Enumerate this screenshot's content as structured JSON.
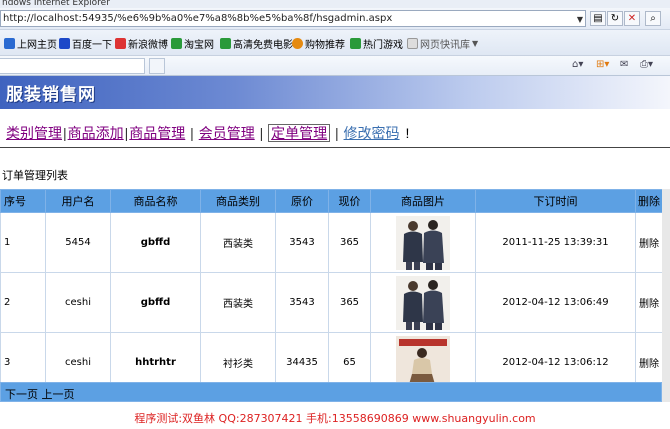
{
  "window": {
    "title": "ndows Internet Explorer"
  },
  "address": {
    "url": "http://localhost:54935/%e6%9b%a0%e7%a8%8b%e5%ba%8f/hsgadmin.aspx"
  },
  "favorites": [
    {
      "label": "上网主页",
      "color": "#2a6ad1"
    },
    {
      "label": "百度一下",
      "color": "#1d48c8"
    },
    {
      "label": "新浪微博",
      "color": "#d33"
    },
    {
      "label": "淘宝网",
      "color": "#2a9a3a"
    },
    {
      "label": "高清免费电影",
      "color": "#2a9a3a"
    },
    {
      "label": "购物推荐",
      "color": "#e58a10"
    },
    {
      "label": "热门游戏",
      "color": "#2a9a3a"
    },
    {
      "label": "网页快讯库",
      "color": "#888"
    }
  ],
  "banner": {
    "title": "服装销售网"
  },
  "nav": {
    "items": [
      "类别管理",
      "商品添加",
      "商品管理",
      "会员管理",
      "定单管理",
      "修改密码"
    ],
    "trailing": "!"
  },
  "list": {
    "title": "订单管理列表",
    "headers": [
      "序号",
      "用户名",
      "商品名称",
      "商品类别",
      "原价",
      "现价",
      "商品图片",
      "下订时间",
      "删除"
    ],
    "rows": [
      {
        "id": "1",
        "user": "5454",
        "name": "gbffd",
        "category": "西装类",
        "orig": "3543",
        "price": "365",
        "image": "jacket-couple-photo",
        "time": "2011-11-25 13:39:31",
        "delete": "删除"
      },
      {
        "id": "2",
        "user": "ceshi",
        "name": "gbffd",
        "category": "西装类",
        "orig": "3543",
        "price": "365",
        "image": "jacket-couple-photo",
        "time": "2012-04-12 13:06:49",
        "delete": "删除"
      },
      {
        "id": "3",
        "user": "ceshi",
        "name": "hhtrhtr",
        "category": "衬衫类",
        "orig": "34435",
        "price": "65",
        "image": "magazine-cover-photo",
        "time": "2012-04-12 13:06:12",
        "delete": "删除"
      }
    ],
    "pager": {
      "next": "下一页",
      "prev": "上一页"
    }
  },
  "footer": "程序测试:双鱼林 QQ:287307421 手机:13558690869 www.shuangyulin.com"
}
